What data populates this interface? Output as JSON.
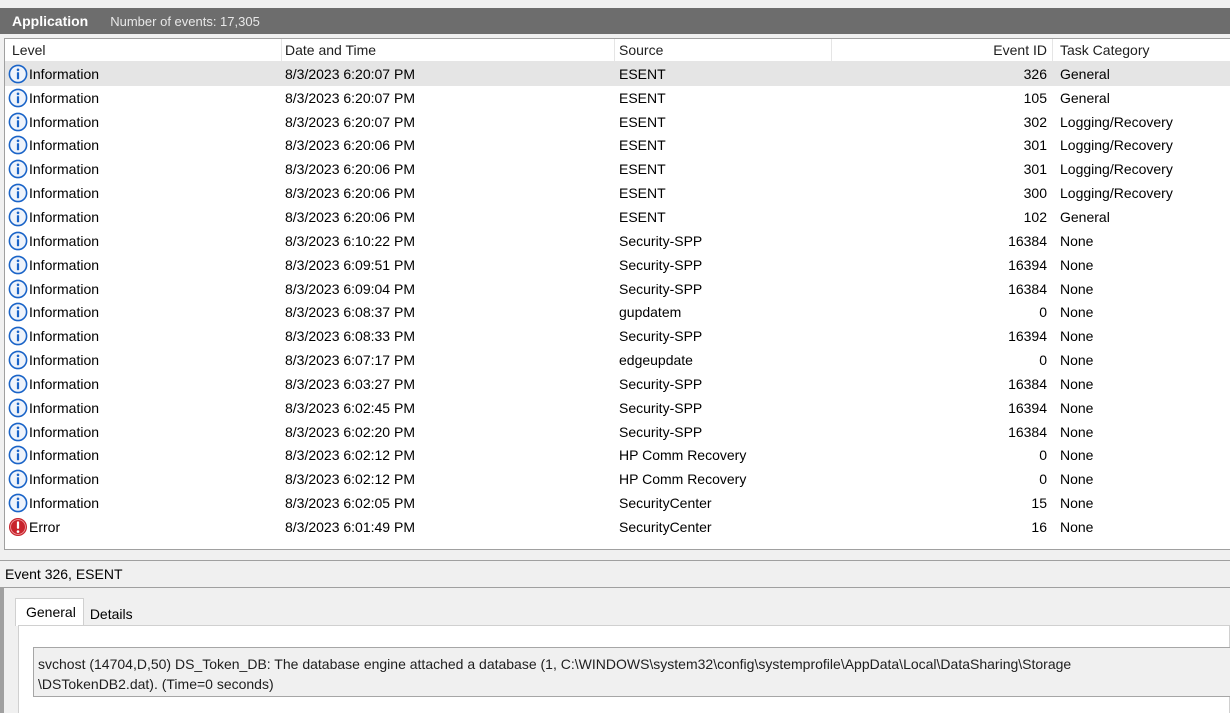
{
  "header": {
    "log_name": "Application",
    "event_count_text": "Number of events: 17,305"
  },
  "columns": {
    "level": "Level",
    "date": "Date and Time",
    "source": "Source",
    "event_id": "Event ID",
    "task": "Task Category"
  },
  "colors": {
    "info_icon": "#1a64c8",
    "error_icon": "#c8232c",
    "selected_row": "#e5e5e5",
    "title_bar": "#6d6d6d"
  },
  "events": [
    {
      "level": "Information",
      "icon": "info-icon",
      "date": "8/3/2023 6:20:07 PM",
      "source": "ESENT",
      "event_id": "326",
      "task": "General"
    },
    {
      "level": "Information",
      "icon": "info-icon",
      "date": "8/3/2023 6:20:07 PM",
      "source": "ESENT",
      "event_id": "105",
      "task": "General"
    },
    {
      "level": "Information",
      "icon": "info-icon",
      "date": "8/3/2023 6:20:07 PM",
      "source": "ESENT",
      "event_id": "302",
      "task": "Logging/Recovery"
    },
    {
      "level": "Information",
      "icon": "info-icon",
      "date": "8/3/2023 6:20:06 PM",
      "source": "ESENT",
      "event_id": "301",
      "task": "Logging/Recovery"
    },
    {
      "level": "Information",
      "icon": "info-icon",
      "date": "8/3/2023 6:20:06 PM",
      "source": "ESENT",
      "event_id": "301",
      "task": "Logging/Recovery"
    },
    {
      "level": "Information",
      "icon": "info-icon",
      "date": "8/3/2023 6:20:06 PM",
      "source": "ESENT",
      "event_id": "300",
      "task": "Logging/Recovery"
    },
    {
      "level": "Information",
      "icon": "info-icon",
      "date": "8/3/2023 6:20:06 PM",
      "source": "ESENT",
      "event_id": "102",
      "task": "General"
    },
    {
      "level": "Information",
      "icon": "info-icon",
      "date": "8/3/2023 6:10:22 PM",
      "source": "Security-SPP",
      "event_id": "16384",
      "task": "None"
    },
    {
      "level": "Information",
      "icon": "info-icon",
      "date": "8/3/2023 6:09:51 PM",
      "source": "Security-SPP",
      "event_id": "16394",
      "task": "None"
    },
    {
      "level": "Information",
      "icon": "info-icon",
      "date": "8/3/2023 6:09:04 PM",
      "source": "Security-SPP",
      "event_id": "16384",
      "task": "None"
    },
    {
      "level": "Information",
      "icon": "info-icon",
      "date": "8/3/2023 6:08:37 PM",
      "source": "gupdatem",
      "event_id": "0",
      "task": "None"
    },
    {
      "level": "Information",
      "icon": "info-icon",
      "date": "8/3/2023 6:08:33 PM",
      "source": "Security-SPP",
      "event_id": "16394",
      "task": "None"
    },
    {
      "level": "Information",
      "icon": "info-icon",
      "date": "8/3/2023 6:07:17 PM",
      "source": "edgeupdate",
      "event_id": "0",
      "task": "None"
    },
    {
      "level": "Information",
      "icon": "info-icon",
      "date": "8/3/2023 6:03:27 PM",
      "source": "Security-SPP",
      "event_id": "16384",
      "task": "None"
    },
    {
      "level": "Information",
      "icon": "info-icon",
      "date": "8/3/2023 6:02:45 PM",
      "source": "Security-SPP",
      "event_id": "16394",
      "task": "None"
    },
    {
      "level": "Information",
      "icon": "info-icon",
      "date": "8/3/2023 6:02:20 PM",
      "source": "Security-SPP",
      "event_id": "16384",
      "task": "None"
    },
    {
      "level": "Information",
      "icon": "info-icon",
      "date": "8/3/2023 6:02:12 PM",
      "source": "HP Comm Recovery",
      "event_id": "0",
      "task": "None"
    },
    {
      "level": "Information",
      "icon": "info-icon",
      "date": "8/3/2023 6:02:12 PM",
      "source": "HP Comm Recovery",
      "event_id": "0",
      "task": "None"
    },
    {
      "level": "Information",
      "icon": "info-icon",
      "date": "8/3/2023 6:02:05 PM",
      "source": "SecurityCenter",
      "event_id": "15",
      "task": "None"
    },
    {
      "level": "Error",
      "icon": "error-icon",
      "date": "8/3/2023 6:01:49 PM",
      "source": "SecurityCenter",
      "event_id": "16",
      "task": "None"
    }
  ],
  "detail": {
    "title": "Event 326, ESENT",
    "tabs": [
      "General",
      "Details"
    ],
    "message_line1": "svchost (14704,D,50) DS_Token_DB: The database engine attached a database (1, C:\\WINDOWS\\system32\\config\\systemprofile\\AppData\\Local\\DataSharing\\Storage",
    "message_line2": "\\DSTokenDB2.dat). (Time=0 seconds)"
  }
}
